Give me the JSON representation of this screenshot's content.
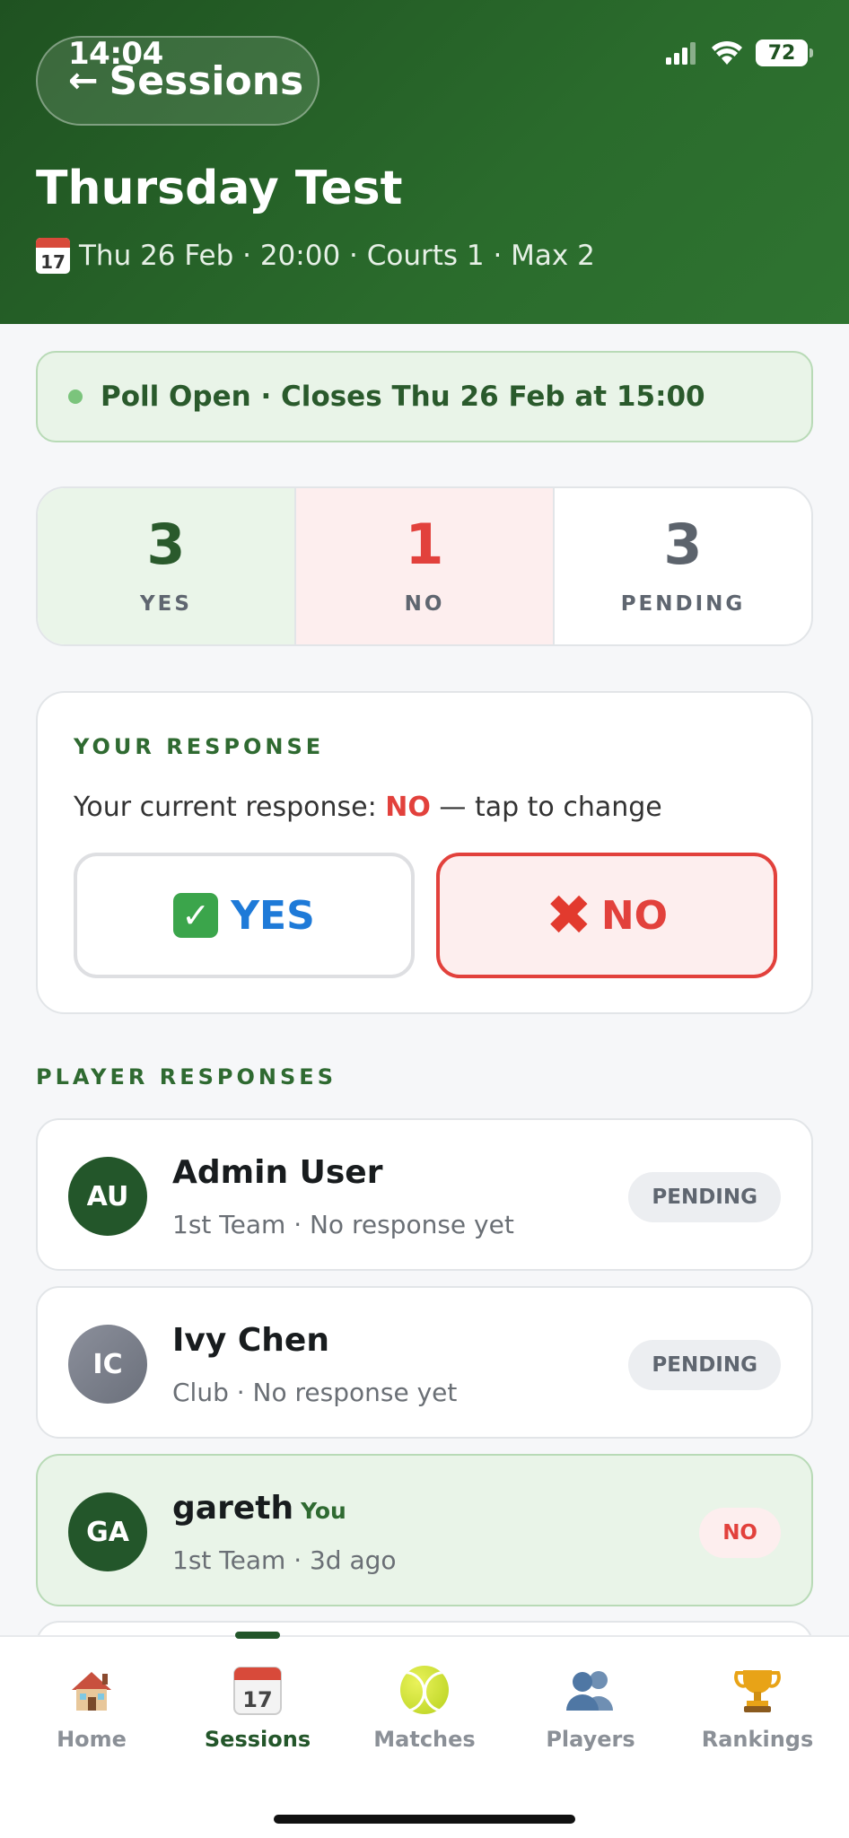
{
  "status_bar": {
    "time": "14:04",
    "battery": "72"
  },
  "header": {
    "back_label": "Sessions",
    "title": "Thursday Test",
    "meta": "Thu 26 Feb · 20:00 · Courts 1 · Max 2"
  },
  "poll": {
    "text": "Poll Open · Closes Thu 26 Feb at 15:00"
  },
  "counts": {
    "yes": {
      "value": "3",
      "label": "YES"
    },
    "no": {
      "value": "1",
      "label": "NO"
    },
    "pending": {
      "value": "3",
      "label": "PENDING"
    }
  },
  "your_response": {
    "heading": "YOUR RESPONSE",
    "prefix": "Your current response: ",
    "value": "NO",
    "suffix": " — tap to change",
    "yes_label": "YES",
    "no_label": "NO"
  },
  "players": {
    "heading": "PLAYER RESPONSES",
    "items": [
      {
        "initials": "AU",
        "name": "Admin User",
        "you": "",
        "sub": "1st Team · No response yet",
        "status": "PENDING"
      },
      {
        "initials": "IC",
        "name": "Ivy Chen",
        "you": "",
        "sub": "Club · No response yet",
        "status": "PENDING"
      },
      {
        "initials": "GA",
        "name": "gareth",
        "you": "You",
        "sub": "1st Team · 3d ago",
        "status": "NO"
      }
    ]
  },
  "nav": {
    "items": [
      {
        "label": "Home",
        "icon": "house-icon"
      },
      {
        "label": "Sessions",
        "icon": "calendar-icon"
      },
      {
        "label": "Matches",
        "icon": "tennis-ball-icon"
      },
      {
        "label": "Players",
        "icon": "people-icon"
      },
      {
        "label": "Rankings",
        "icon": "trophy-icon"
      }
    ],
    "active": "Sessions"
  },
  "colors": {
    "brand": "#23562a",
    "yes": "#2a5a2c",
    "no": "#e2413c",
    "yes_button": "#1e7ad8"
  }
}
